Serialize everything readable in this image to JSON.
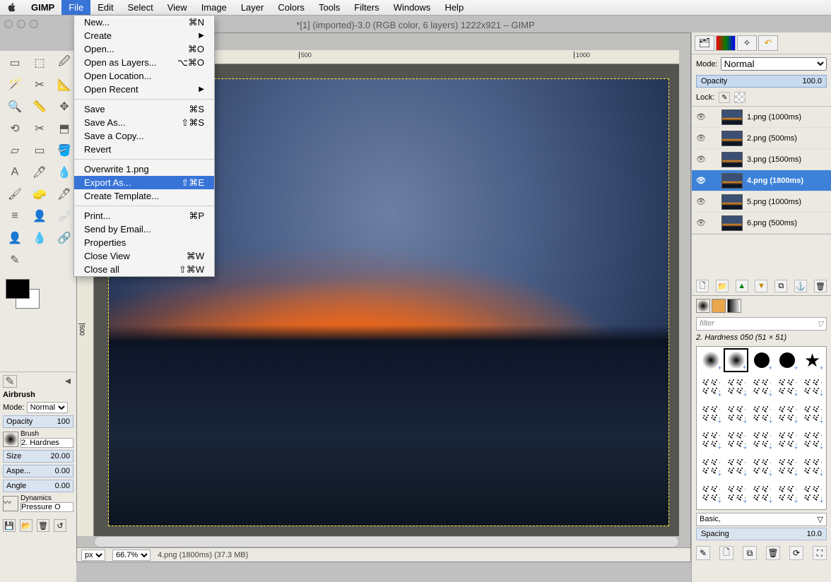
{
  "menubar": {
    "app": "GIMP",
    "items": [
      "File",
      "Edit",
      "Select",
      "View",
      "Image",
      "Layer",
      "Colors",
      "Tools",
      "Filters",
      "Windows",
      "Help"
    ],
    "active": "File"
  },
  "filemenu": {
    "groups": [
      [
        {
          "label": "New...",
          "accel": "⌘N"
        },
        {
          "label": "Create",
          "submenu": true
        },
        {
          "label": "Open...",
          "accel": "⌘O"
        },
        {
          "label": "Open as Layers...",
          "accel": "⌥⌘O"
        },
        {
          "label": "Open Location..."
        },
        {
          "label": "Open Recent",
          "submenu": true
        }
      ],
      [
        {
          "label": "Save",
          "accel": "⌘S"
        },
        {
          "label": "Save As...",
          "accel": "⇧⌘S"
        },
        {
          "label": "Save a Copy..."
        },
        {
          "label": "Revert"
        }
      ],
      [
        {
          "label": "Overwrite 1.png"
        },
        {
          "label": "Export As...",
          "accel": "⇧⌘E",
          "highlight": true
        },
        {
          "label": "Create Template..."
        }
      ],
      [
        {
          "label": "Print...",
          "accel": "⌘P"
        },
        {
          "label": "Send by Email..."
        },
        {
          "label": "Properties"
        },
        {
          "label": "Close View",
          "accel": "⌘W"
        },
        {
          "label": "Close all",
          "accel": "⇧⌘W"
        }
      ]
    ]
  },
  "window": {
    "title": "*[1] (imported)-3.0 (RGB color, 6 layers) 1222x921 – GIMP"
  },
  "ruler": {
    "top": [
      "500",
      "1000"
    ],
    "left": [
      "500"
    ]
  },
  "tooloptions": {
    "title": "Airbrush",
    "mode_label": "Mode:",
    "mode_value": "Normal",
    "opacity_label": "Opacity",
    "opacity_value": "100",
    "brush_label": "Brush",
    "brush_value": "2. Hardnes",
    "size_label": "Size",
    "size_value": "20.00",
    "aspect_label": "Aspe...",
    "aspect_value": "0.00",
    "angle_label": "Angle",
    "angle_value": "0.00",
    "dynamics_label": "Dynamics",
    "dynamics_value": "Pressure O"
  },
  "layers": {
    "mode_label": "Mode:",
    "mode_value": "Normal",
    "opacity_label": "Opacity",
    "opacity_value": "100.0",
    "lock_label": "Lock:",
    "items": [
      {
        "name": "1.png (1000ms)",
        "visible": true
      },
      {
        "name": "2.png (500ms)",
        "visible": true
      },
      {
        "name": "3.png (1500ms)",
        "visible": true
      },
      {
        "name": "4.png (1800ms)",
        "visible": true,
        "selected": true
      },
      {
        "name": "5.png (1000ms)",
        "visible": true
      },
      {
        "name": "6.png (500ms)",
        "visible": true
      }
    ]
  },
  "brushes": {
    "filter_placeholder": "filter",
    "selected": "2. Hardness 050 (51 × 51)",
    "preset": "Basic,",
    "spacing_label": "Spacing",
    "spacing_value": "10.0"
  },
  "status": {
    "unit": "px",
    "zoom": "66.7%",
    "info": "4.png (1800ms) (37.3 MB)"
  }
}
